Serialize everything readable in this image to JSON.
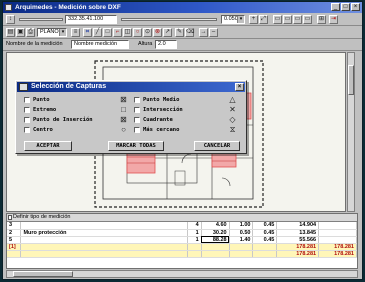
{
  "window": {
    "title": "Arquimedes - Medición sobre DXF",
    "controls": [
      "_",
      "□",
      "×"
    ]
  },
  "toolbar1": {
    "coord_value": "332.35.41.100",
    "zoom_value": "0.050",
    "layer_value": "PLANO"
  },
  "measure_bar": {
    "name_label": "Nombre de la medición",
    "name_value": "Nombre medición",
    "height_label": "Altura",
    "height_value": "2.0"
  },
  "dialog": {
    "title": "Selección de Capturas",
    "options_left": [
      "Punto",
      "Extremo",
      "Punto de Inserción",
      "Centro"
    ],
    "options_right": [
      "Punto Medio",
      "Intersección",
      "Cuadrante",
      "Más cercano"
    ],
    "buttons": {
      "accept": "ACEPTAR",
      "select_all": "MARCAR TODAS",
      "cancel": "CANCELAR"
    }
  },
  "measurements": {
    "header": "Definir tipo de medición",
    "rows": [
      {
        "id": "3",
        "desc": "",
        "qty": "4",
        "len": "4.60",
        "wid": "1.00",
        "hei": "0.45",
        "partial": "14.904",
        "total": ""
      },
      {
        "id": "2",
        "desc": "Muro protección",
        "qty": "1",
        "len": "30.20",
        "wid": "0.50",
        "hei": "0.45",
        "partial": "13.845",
        "total": ""
      },
      {
        "id": "5",
        "desc": "",
        "qty": "1",
        "len": "88.28",
        "wid": "1.40",
        "hei": "0.45",
        "partial": "55.566",
        "total": ""
      },
      {
        "id": "[1]",
        "desc": "",
        "qty": "",
        "len": "",
        "wid": "",
        "hei": "",
        "partial": "178.281",
        "total": "178.281"
      },
      {
        "id": "",
        "desc": "",
        "qty": "",
        "len": "",
        "wid": "",
        "hei": "",
        "partial": "178.281",
        "total": "178.281"
      }
    ]
  },
  "colors": {
    "titlebar": "#0a2a84",
    "chrome": "#c0c0c0",
    "selection_red": "#e05050",
    "total_row": "#fff6b8"
  }
}
